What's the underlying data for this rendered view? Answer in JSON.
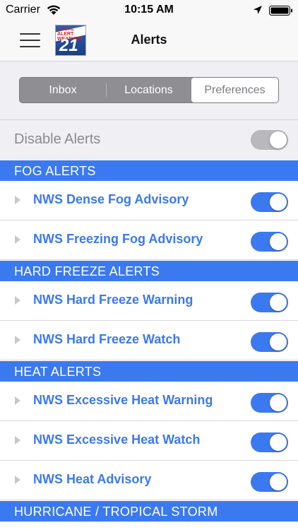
{
  "status_bar": {
    "carrier": "Carrier",
    "time": "10:15 AM",
    "icons": [
      "wifi-icon",
      "location-arrow-icon",
      "battery-icon"
    ]
  },
  "nav": {
    "title": "Alerts",
    "menu_icon": "hamburger-menu-icon",
    "logo": {
      "text": "LOCAL ALERT WEATHER",
      "number": "21"
    }
  },
  "tabs": [
    {
      "label": "Inbox",
      "selected": false
    },
    {
      "label": "Locations",
      "selected": false
    },
    {
      "label": "Preferences",
      "selected": true
    }
  ],
  "disable_alerts": {
    "label": "Disable Alerts",
    "toggle_on": true
  },
  "sections": [
    {
      "title": "FOG ALERTS",
      "items": [
        {
          "label": "NWS Dense Fog Advisory",
          "enabled": true
        },
        {
          "label": "NWS Freezing Fog Advisory",
          "enabled": true
        }
      ]
    },
    {
      "title": "HARD FREEZE ALERTS",
      "items": [
        {
          "label": "NWS Hard Freeze Warning",
          "enabled": true
        },
        {
          "label": "NWS Hard Freeze Watch",
          "enabled": true
        }
      ]
    },
    {
      "title": "HEAT ALERTS",
      "items": [
        {
          "label": "NWS Excessive Heat Warning",
          "enabled": true
        },
        {
          "label": "NWS Excessive Heat Watch",
          "enabled": true
        },
        {
          "label": "NWS Heat Advisory",
          "enabled": true
        }
      ]
    },
    {
      "title": "HURRICANE / TROPICAL STORM",
      "items": []
    }
  ],
  "colors": {
    "accent": "#3b79f0",
    "segment_bg": "#8e8e93",
    "grouped_bg": "#efeff4",
    "disabled_toggle": "#b8b8bd"
  }
}
